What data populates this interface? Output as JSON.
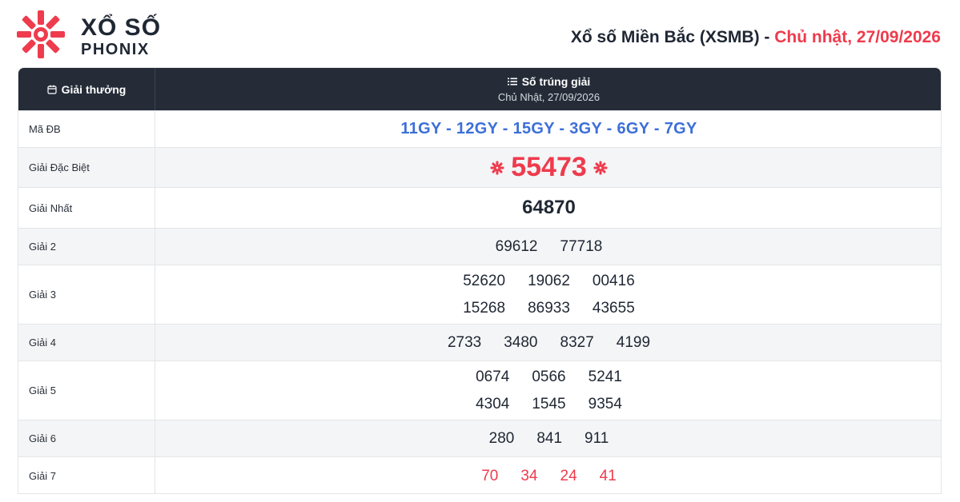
{
  "brand": {
    "line1": "XỔ SỐ",
    "line2": "PHONIX",
    "color": "#ee3b4d"
  },
  "page": {
    "title_main": "Xổ số Miền Bắc (XSMB) - ",
    "title_date": "Chủ nhật, 27/09/2026"
  },
  "table": {
    "col_prize": "Giải thưởng",
    "col_numbers": "Số trúng giải",
    "col_date": "Chủ Nhật, 27/09/2026"
  },
  "rows": {
    "ma_db": {
      "label": "Mã ĐB",
      "value": "11GY - 12GY - 15GY - 3GY - 6GY - 7GY"
    },
    "dac_biet": {
      "label": "Giải Đặc Biệt",
      "value": "55473"
    },
    "nhat": {
      "label": "Giải Nhất",
      "value": "64870"
    },
    "g2": {
      "label": "Giải 2",
      "values": [
        "69612",
        "77718"
      ]
    },
    "g3": {
      "label": "Giải 3",
      "values": [
        "52620",
        "19062",
        "00416",
        "15268",
        "86933",
        "43655"
      ]
    },
    "g4": {
      "label": "Giải 4",
      "values": [
        "2733",
        "3480",
        "8327",
        "4199"
      ]
    },
    "g5": {
      "label": "Giải 5",
      "values": [
        "0674",
        "0566",
        "5241",
        "4304",
        "1545",
        "9354"
      ]
    },
    "g6": {
      "label": "Giải 6",
      "values": [
        "280",
        "841",
        "911"
      ]
    },
    "g7": {
      "label": "Giải 7",
      "values": [
        "70",
        "34",
        "24",
        "41"
      ]
    }
  },
  "colors": {
    "accent": "#ee3b4d",
    "code_blue": "#3c6fd8",
    "header_bg": "#252c38"
  }
}
